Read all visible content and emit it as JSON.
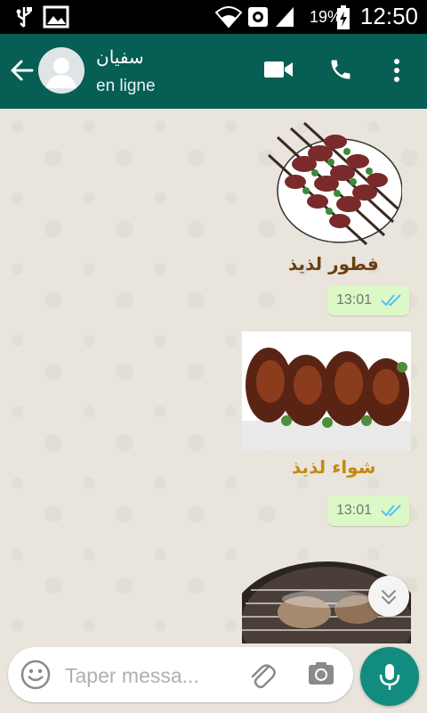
{
  "status_bar": {
    "time": "12:50",
    "battery_percent": "19%",
    "icons": [
      "usb-icon",
      "image-icon",
      "wifi-icon",
      "data-saver-icon",
      "signal-icon",
      "battery-charging-icon"
    ]
  },
  "header": {
    "contact_name": "سفيان",
    "contact_status": "en ligne",
    "icons": [
      "back-arrow-icon",
      "avatar-placeholder-icon",
      "video-call-icon",
      "phone-icon",
      "more-vert-icon"
    ]
  },
  "messages": [
    {
      "type": "sticker",
      "caption": "فطور لذيذ",
      "time": "13:01",
      "status": "read"
    },
    {
      "type": "sticker",
      "caption": "شواء لذيذ",
      "time": "13:01",
      "status": "read"
    },
    {
      "type": "sticker",
      "caption": "",
      "time": "",
      "status": ""
    }
  ],
  "composer": {
    "placeholder": "Taper messa...",
    "icons": [
      "emoji-icon",
      "attach-icon",
      "camera-icon",
      "mic-icon"
    ]
  },
  "colors": {
    "header": "#075e54",
    "bubble": "#dcf8c6",
    "mic_button": "#128c7e",
    "read_ticks": "#4fc3f7",
    "chat_background": "#e9e4dc"
  }
}
